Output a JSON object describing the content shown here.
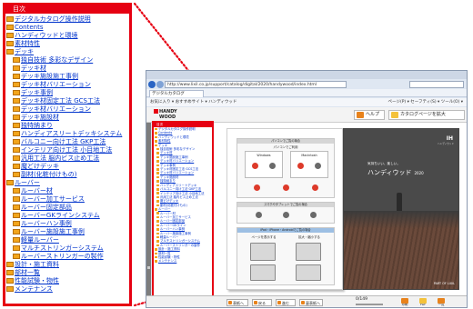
{
  "zoom_panel": {
    "header": "目次",
    "items": [
      {
        "label": "デジタルカタログ操作説明",
        "level": 1
      },
      {
        "label": "Contents",
        "level": 1
      },
      {
        "label": "ハンディウッドと環境",
        "level": 1
      },
      {
        "label": "素材特性",
        "level": 1
      },
      {
        "label": "デッキ",
        "level": 1
      },
      {
        "label": "独自技術 多彩なデザイン",
        "level": 2
      },
      {
        "label": "デッキ材",
        "level": 2
      },
      {
        "label": "デッキ施設施工事例",
        "level": 2
      },
      {
        "label": "デッキ材バリエーション",
        "level": 2
      },
      {
        "label": "デッキ事例",
        "level": 2
      },
      {
        "label": "デッキ材固定工法 GCS工法",
        "level": 2
      },
      {
        "label": "デッキ材バリエーション",
        "level": 2
      },
      {
        "label": "デッキ施設材",
        "level": 2
      },
      {
        "label": "独特納まり",
        "level": 2
      },
      {
        "label": "ハンディアスリートデッキシステム",
        "level": 2,
        "wrap": true
      },
      {
        "label": "バルコニー向け工法 GKP工法",
        "level": 2
      },
      {
        "label": "インテリア向け工法 小目地工法",
        "level": 2
      },
      {
        "label": "汎用工法 脳内ビス止め工法",
        "level": 2
      },
      {
        "label": "魔どけデッキ",
        "level": 2
      },
      {
        "label": "副材(化粧付けもの)",
        "level": 2
      },
      {
        "label": "ルーバー",
        "level": 1
      },
      {
        "label": "ルーバー材",
        "level": 2
      },
      {
        "label": "ルーバー加工サービス",
        "level": 2
      },
      {
        "label": "ルーバー固定部品",
        "level": 2
      },
      {
        "label": "ルーバーGKラインシステム",
        "level": 2
      },
      {
        "label": "ルーバーハン事例",
        "level": 2
      },
      {
        "label": "ルーバー施設施工事例",
        "level": 2
      },
      {
        "label": "軽量ルーバー",
        "level": 2
      },
      {
        "label": "マルチストリンガーシステム",
        "level": 2
      },
      {
        "label": "ルーバーストリンガーの製作",
        "level": 2
      },
      {
        "label": "設計・施工資料",
        "level": 1
      },
      {
        "label": "部材一覧",
        "level": 1
      },
      {
        "label": "性能試験・物性",
        "level": 1
      },
      {
        "label": "メンテナンス",
        "level": 1
      }
    ]
  },
  "browser": {
    "url": "http://www.lixil.co.jp/support/catalog/digital/2020/handywood/index.html",
    "tab_title": "デジタルカタログ",
    "bookmarks": "お気に入り  ▾  おすすめサイト  ▾  ハンディウッド",
    "tools": "ページ(P) ▾  セーフティ(S) ▾  ツール(O) ▾"
  },
  "viewer": {
    "logo_line1": "HANDY",
    "logo_line2": "WOOD",
    "help_label": "ヘルプ",
    "zoom_label": "カタログページを拡大",
    "toc_header": "目次",
    "toc_items": [
      "デジタルカタログ操作説明",
      "Contents",
      "ハンディウッドと環境",
      "素材特性",
      "デッキ",
      "独自技術 多彩なデザイン",
      "デッキ材",
      "デッキ施設施工事例",
      "デッキ材バリエーション",
      "デッキ事例",
      "デッキ材固定工法 GCS工法",
      "デッキ材バリエーション",
      "デッキ施設材",
      "独特納まり",
      "ハンディアスリートデッキ",
      "バルコニー向け工法 GKP工法",
      "インテリア向け工法 小目地工法",
      "汎用工法 脳内ビス止め工法",
      "魔どけデッキ",
      "副材(化粧付けもの)",
      "ルーバー",
      "ルーバー材",
      "ルーバー加工サービス",
      "ルーバー固定部品",
      "ルーバーGKライン",
      "ルーバーハン事例",
      "ルーバー施設施工事例",
      "軽量ルーバー",
      "マルチストリンガーシステム",
      "ルーバーストリンガーの製作",
      "設計・施工資料",
      "部材一覧",
      "性能試験・物性",
      "メンテナンス"
    ],
    "left_page": {
      "sec1_title": "パソコンでご覧の場合",
      "sec1_sub": "パソコンでご利用",
      "win_label": "Windows",
      "mac_label": "Macintosh",
      "sec2_title": "スマホやタブレットでご覧の場合",
      "sec3_title": "iPad・iPhone・Androidでご覧の場合",
      "page_btn_label": "ページを表示する",
      "zoom_btn_label": "拡大・縮小する"
    },
    "right_page": {
      "brand": "IH",
      "brand_sub": "ハンディウッド",
      "tag": "気持ちいい、楽しい。",
      "title": "ハンディウッド",
      "year": "2020",
      "footer": "PART OF LIXIL"
    },
    "nav": {
      "first": "表紙へ",
      "back": "戻る",
      "next": "進む",
      "last": "裏表紙へ",
      "page_display": "0/149",
      "btn_print": "印刷",
      "btn_pdf": "PDF",
      "btn_list": "一覧"
    }
  },
  "colors": {
    "accent_red": "#e60012",
    "link_blue": "#0033cc",
    "folder_orange": "#f2a51c"
  }
}
